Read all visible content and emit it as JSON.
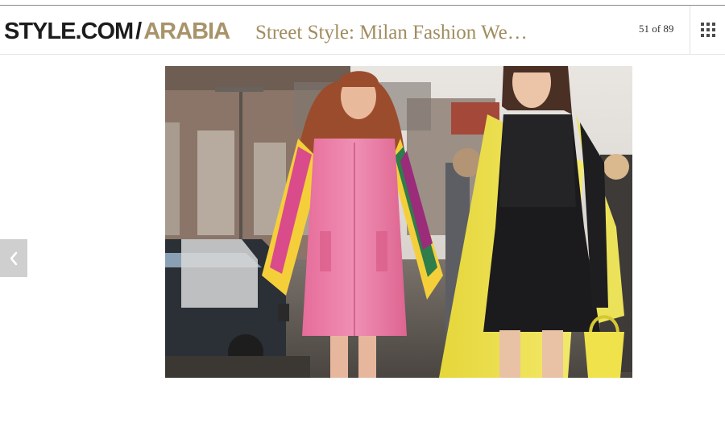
{
  "header": {
    "logo": {
      "primary": "STYLE.COM",
      "separator": "/",
      "accent": "ARABIA"
    },
    "gallery_title": "Street Style: Milan Fashion We…",
    "counter": "51 of 89",
    "grid_button_icon": "grid-icon"
  },
  "photo": {
    "subject": "street-style-photo"
  },
  "navigation": {
    "prev_icon": "chevron-left-icon"
  },
  "colors": {
    "logo_primary": "#1c1c1c",
    "logo_accent": "#a8936a",
    "title": "#a08c5f",
    "nav_button": "#cfcfcf"
  }
}
